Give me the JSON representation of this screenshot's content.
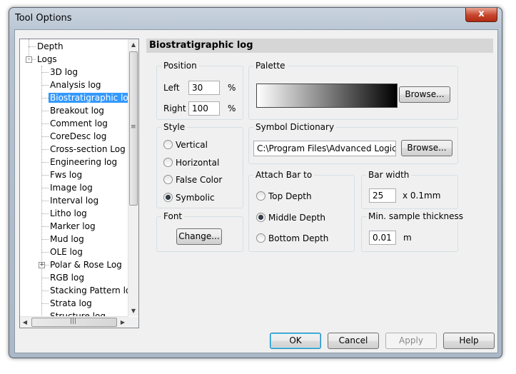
{
  "window": {
    "title": "Tool Options",
    "close_glyph": "x"
  },
  "tree": {
    "items": [
      {
        "label": "Depth",
        "level": 0
      },
      {
        "label": "Logs",
        "level": 0,
        "expander": "-"
      },
      {
        "label": "3D log",
        "level": 1
      },
      {
        "label": "Analysis log",
        "level": 1
      },
      {
        "label": "Biostratigraphic log",
        "level": 1,
        "selected": true
      },
      {
        "label": "Breakout log",
        "level": 1
      },
      {
        "label": "Comment log",
        "level": 1
      },
      {
        "label": "CoreDesc log",
        "level": 1
      },
      {
        "label": "Cross-section Log",
        "level": 1
      },
      {
        "label": "Engineering log",
        "level": 1
      },
      {
        "label": "Fws log",
        "level": 1
      },
      {
        "label": "Image log",
        "level": 1
      },
      {
        "label": "Interval log",
        "level": 1
      },
      {
        "label": "Litho log",
        "level": 1
      },
      {
        "label": "Marker log",
        "level": 1
      },
      {
        "label": "Mud log",
        "level": 1
      },
      {
        "label": "OLE log",
        "level": 1
      },
      {
        "label": "Polar & Rose Log",
        "level": 1,
        "expander": "+"
      },
      {
        "label": "RGB log",
        "level": 1
      },
      {
        "label": "Stacking Pattern log",
        "level": 1
      },
      {
        "label": "Strata log",
        "level": 1
      },
      {
        "label": "Structure log",
        "level": 1
      }
    ],
    "scroll_up": "▲",
    "scroll_down": "▼",
    "scroll_left": "◀",
    "scroll_right": "▶",
    "vgrip": "≡",
    "hgrip": "|||"
  },
  "panel": {
    "title": "Biostratigraphic log",
    "position": {
      "title": "Position",
      "left_label": "Left",
      "left_value": "30",
      "left_unit": "%",
      "right_label": "Right",
      "right_value": "100",
      "right_unit": "%"
    },
    "palette": {
      "title": "Palette",
      "browse": "Browse..."
    },
    "style": {
      "title": "Style",
      "options": [
        "Vertical",
        "Horizontal",
        "False Color",
        "Symbolic"
      ],
      "selected": "Symbolic"
    },
    "symbol_dictionary": {
      "title": "Symbol Dictionary",
      "path": "C:\\Program Files\\Advanced Logic Tech",
      "browse": "Browse..."
    },
    "attach_bar": {
      "title": "Attach Bar to",
      "options": [
        "Top Depth",
        "Middle Depth",
        "Bottom Depth"
      ],
      "selected": "Middle Depth"
    },
    "bar_width": {
      "title": "Bar width",
      "value": "25",
      "unit": "x 0.1mm"
    },
    "min_sample": {
      "title": "Min. sample thickness",
      "value": "0.01",
      "unit": "m"
    },
    "font": {
      "title": "Font",
      "change": "Change..."
    }
  },
  "buttons": {
    "ok": "OK",
    "cancel": "Cancel",
    "apply": "Apply",
    "help": "Help"
  }
}
